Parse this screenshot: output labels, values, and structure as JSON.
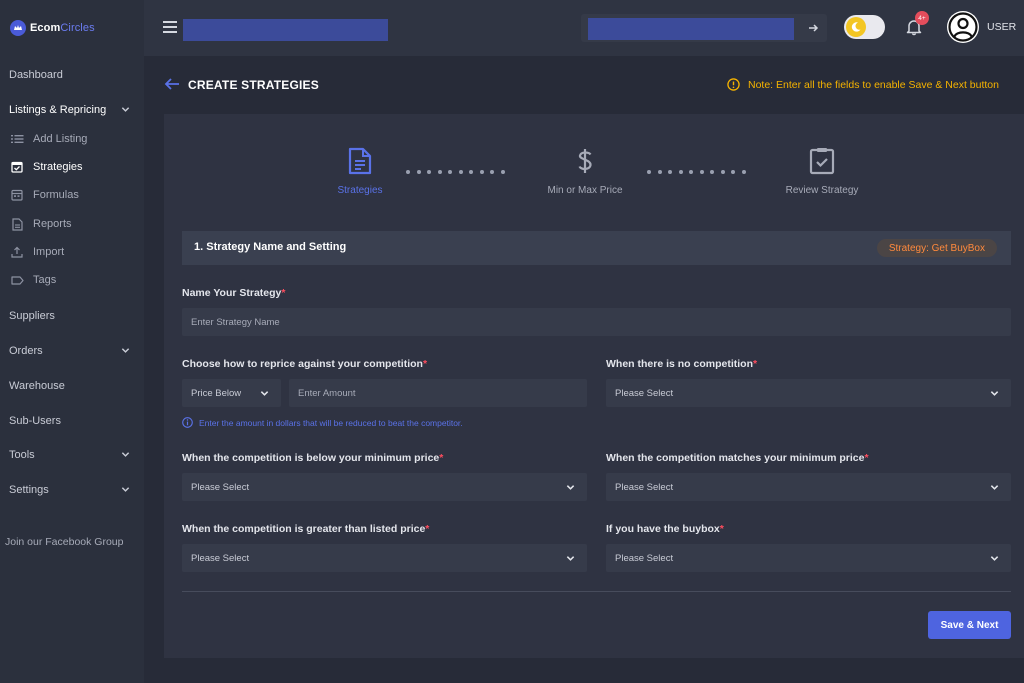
{
  "brand": {
    "name_part1": "Ecom",
    "name_part2": "Circles"
  },
  "sidebar": {
    "items": [
      {
        "label": "Dashboard"
      },
      {
        "label": "Listings & Repricing"
      },
      {
        "label": "Suppliers"
      },
      {
        "label": "Orders"
      },
      {
        "label": "Warehouse"
      },
      {
        "label": "Sub-Users"
      },
      {
        "label": "Tools"
      },
      {
        "label": "Settings"
      }
    ],
    "sub_items": [
      {
        "label": "Add Listing",
        "icon": "list-icon"
      },
      {
        "label": "Strategies",
        "icon": "calendar-check-icon"
      },
      {
        "label": "Formulas",
        "icon": "calendar-icon"
      },
      {
        "label": "Reports",
        "icon": "document-icon"
      },
      {
        "label": "Import",
        "icon": "upload-icon"
      },
      {
        "label": "Tags",
        "icon": "tag-icon"
      }
    ],
    "footer_link": "Join our Facebook Group"
  },
  "header": {
    "user_label": "USER",
    "notification_count": "4+"
  },
  "page": {
    "title": "CREATE STRATEGIES",
    "note": "Note: Enter all the fields to enable Save & Next button"
  },
  "stepper": {
    "steps": [
      {
        "label": "Strategies",
        "icon": "document-icon",
        "active": true
      },
      {
        "label": "Min or Max Price",
        "icon": "dollar-icon",
        "active": false
      },
      {
        "label": "Review Strategy",
        "icon": "clipboard-check-icon",
        "active": false
      }
    ]
  },
  "section": {
    "title": "1. Strategy Name and Setting",
    "chip": "Strategy: Get BuyBox"
  },
  "form": {
    "name": {
      "label": "Name Your Strategy",
      "placeholder": "Enter Strategy Name"
    },
    "reprice": {
      "label": "Choose how to reprice against your competition",
      "select_value": "Price Below",
      "placeholder": "Enter Amount"
    },
    "no_competition": {
      "label": "When there is no competition",
      "value": "Please Select"
    },
    "hint": "Enter the amount in dollars that will be reduced to beat the competitor.",
    "below_min": {
      "label": "When the competition is below your minimum price",
      "value": "Please Select"
    },
    "matches_min": {
      "label": "When the competition matches your minimum price",
      "value": "Please Select"
    },
    "greater_listed": {
      "label": "When the competition is greater than listed price",
      "value": "Please Select"
    },
    "have_buybox": {
      "label": "If you have the buybox",
      "value": "Please Select"
    },
    "required_mark": "*"
  },
  "actions": {
    "save_next": "Save & Next"
  },
  "colors": {
    "accent": "#4e64e0",
    "warning": "#f5b300",
    "chip_text": "#ff8a3d",
    "required": "#ff4d5e"
  }
}
